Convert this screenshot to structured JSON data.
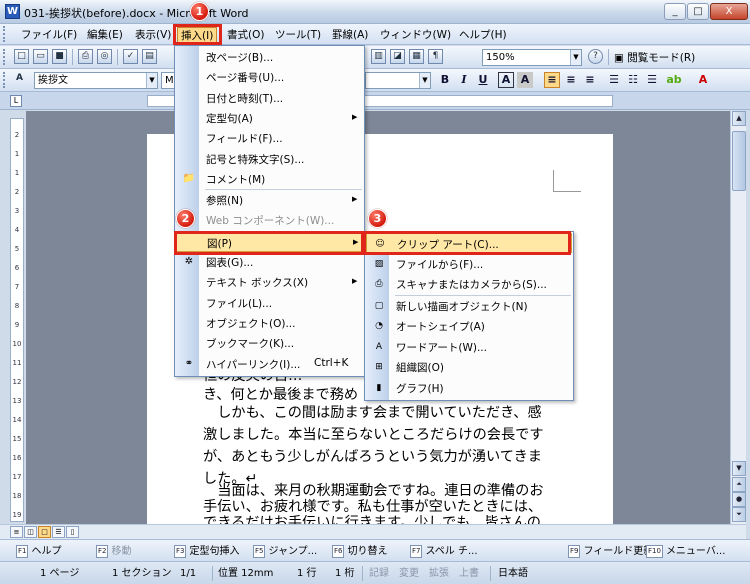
{
  "window": {
    "title": "031-挨拶状(before).docx - Microsoft Word",
    "minimize": "_",
    "maximize": "□",
    "close": "X"
  },
  "menubar": {
    "items": [
      "ファイル(F)",
      "編集(E)",
      "表示(V)",
      "挿入(I)",
      "書式(O)",
      "ツール(T)",
      "罫線(A)",
      "ウィンドウ(W)",
      "ヘルプ(H)"
    ]
  },
  "standard_toolbar": {
    "zoom": "150%",
    "reading_mode": "閲覧モード(R)"
  },
  "format_toolbar": {
    "style": "挨拶文",
    "font": "M",
    "bold": "B",
    "italic": "I",
    "underline": "U"
  },
  "insert_menu": {
    "items": [
      {
        "label": "改ページ(B)...",
        "icon": ""
      },
      {
        "label": "ページ番号(U)...",
        "icon": ""
      },
      {
        "label": "日付と時刻(T)...",
        "icon": ""
      },
      {
        "label": "定型句(A)",
        "icon": "",
        "submenu": true
      },
      {
        "label": "フィールド(F)...",
        "icon": ""
      },
      {
        "label": "記号と特殊文字(S)...",
        "icon": ""
      },
      {
        "label": "コメント(M)",
        "icon": "comment-icon"
      },
      {
        "label": "参照(N)",
        "icon": "",
        "submenu": true
      },
      {
        "label": "Web コンポーネント(W)...",
        "icon": "",
        "disabled": true
      },
      {
        "label": "図(P)",
        "icon": "",
        "submenu": true,
        "highlighted": true
      },
      {
        "label": "図表(G)...",
        "icon": "diagram-icon"
      },
      {
        "label": "テキスト ボックス(X)",
        "icon": "",
        "submenu": true
      },
      {
        "label": "ファイル(L)...",
        "icon": ""
      },
      {
        "label": "オブジェクト(O)...",
        "icon": ""
      },
      {
        "label": "ブックマーク(K)...",
        "icon": ""
      },
      {
        "label": "ハイパーリンク(I)...",
        "icon": "hyperlink-icon",
        "shortcut": "Ctrl+K"
      }
    ]
  },
  "picture_submenu": {
    "items": [
      {
        "label": "クリップ アート(C)...",
        "icon": "clipart-icon",
        "highlighted": true
      },
      {
        "label": "ファイルから(F)...",
        "icon": "picture-file-icon"
      },
      {
        "label": "スキャナまたはカメラから(S)...",
        "icon": "scanner-icon"
      },
      {
        "label": "新しい描画オブジェクト(N)",
        "icon": "drawing-canvas-icon"
      },
      {
        "label": "オートシェイプ(A)",
        "icon": "autoshape-icon"
      },
      {
        "label": "ワードアート(W)...",
        "icon": "wordart-icon"
      },
      {
        "label": "組織図(O)",
        "icon": "org-chart-icon"
      },
      {
        "label": "グラフ(H)",
        "icon": "chart-icon"
      }
    ]
  },
  "annotations": {
    "step1": "1",
    "step2": "2",
    "step3": "3"
  },
  "document": {
    "lines": [
      "恒の皮哭の古…",
      "き、何とか最後まで務め",
      "　しかも、この間は励ます会まで開いていただき、感",
      "激しました。本当に至らないところだらけの会長です",
      "が、あともう少しがんばろうという気力が湧いてきま",
      "した。↵",
      "　当面は、来月の秋期運動会ですね。連日の準備のお",
      "手伝い、お疲れ様です。私も仕事が空いたときには、",
      "できるだけお手伝いに行きます。少しでも、皆さんの"
    ]
  },
  "function_keys": [
    {
      "num": "F1",
      "label": "ヘルプ"
    },
    {
      "num": "F2",
      "label": "移動",
      "dim": true
    },
    {
      "num": "F3",
      "label": "定型句挿入"
    },
    {
      "num": "F5",
      "label": "ジャンプ..."
    },
    {
      "num": "F6",
      "label": "切り替え"
    },
    {
      "num": "F7",
      "label": "スペル チ..."
    },
    {
      "num": "F9",
      "label": "フィールド更新"
    },
    {
      "num": "F10",
      "label": "メニューバ..."
    }
  ],
  "status": {
    "page": "1 ページ",
    "section": "1 セクション",
    "pages": "1/1",
    "position": "位置 12mm",
    "line": "1 行",
    "col": "1 桁",
    "rec": "記録",
    "trk": "変更",
    "ext": "拡張",
    "ovr": "上書",
    "lang": "日本語"
  },
  "ruler_numbers": [
    "2",
    "1",
    "1",
    "2",
    "3",
    "4",
    "5",
    "6",
    "7",
    "8",
    "9",
    "10",
    "11",
    "12",
    "13",
    "14",
    "15",
    "16",
    "17",
    "18",
    "19"
  ]
}
